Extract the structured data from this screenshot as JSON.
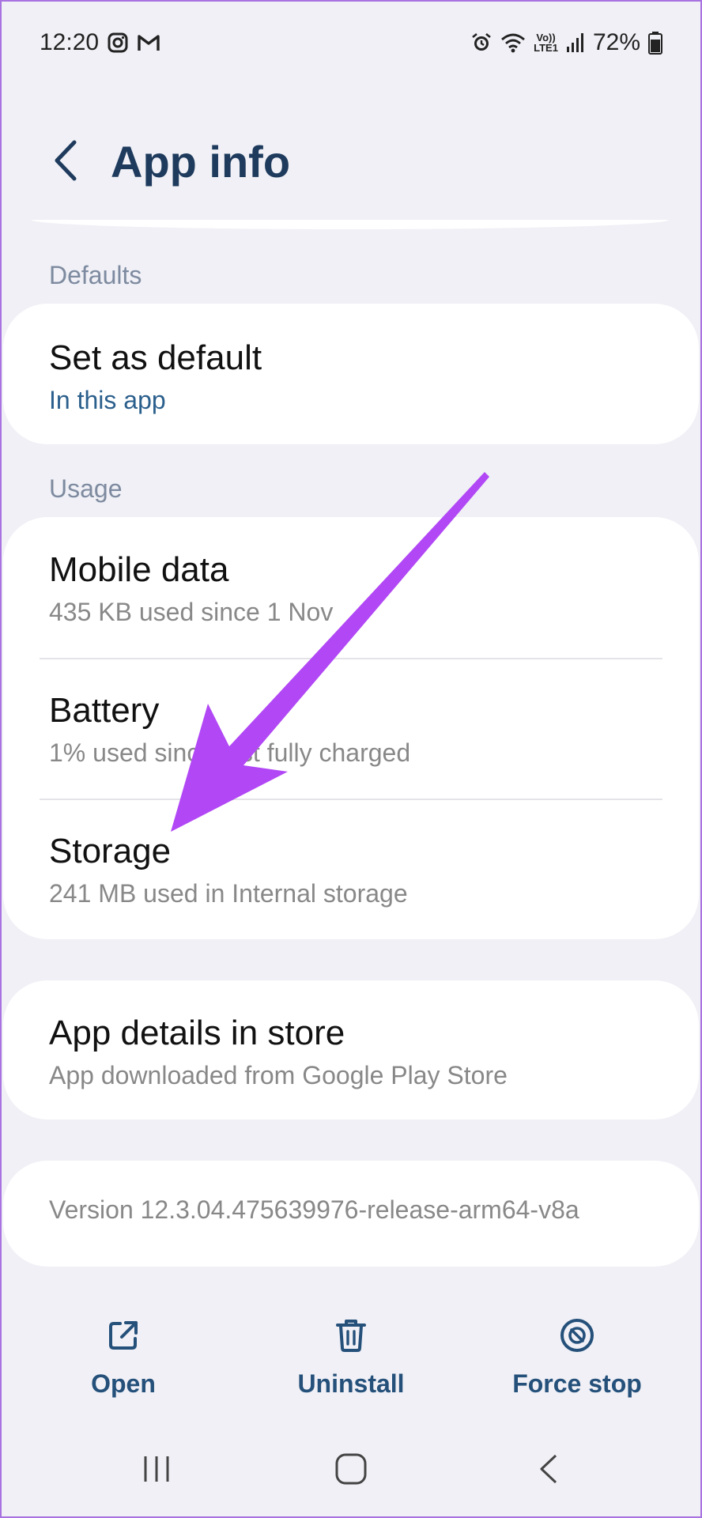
{
  "status_bar": {
    "time": "12:20",
    "left_icons": [
      "instagram-icon",
      "gmail-icon"
    ],
    "right_icons": [
      "alarm-icon",
      "wifi-icon",
      "volte-icon",
      "signal-icon",
      "battery-icon"
    ],
    "network_label_top": "Vo))",
    "network_label_bottom": "LTE1",
    "battery": "72%"
  },
  "header": {
    "title": "App info",
    "back_icon": "chevron-left-icon"
  },
  "sections": {
    "defaults_label": "Defaults",
    "usage_label": "Usage"
  },
  "defaults": {
    "set_as_default": {
      "title": "Set as default",
      "subtitle": "In this app"
    }
  },
  "usage": {
    "mobile_data": {
      "title": "Mobile data",
      "subtitle": "435 KB used since 1 Nov"
    },
    "battery": {
      "title": "Battery",
      "subtitle": "1% used since last fully charged"
    },
    "storage": {
      "title": "Storage",
      "subtitle": "241 MB used in Internal storage"
    }
  },
  "store": {
    "title": "App details in store",
    "subtitle": "App downloaded from Google Play Store"
  },
  "version": "Version 12.3.04.475639976-release-arm64-v8a",
  "actions": {
    "open": {
      "label": "Open",
      "icon": "open-external-icon"
    },
    "uninstall": {
      "label": "Uninstall",
      "icon": "trash-icon"
    },
    "force_stop": {
      "label": "Force stop",
      "icon": "stop-icon"
    }
  },
  "nav": {
    "recents_icon": "recents-icon",
    "home_icon": "home-icon",
    "back_icon": "back-icon"
  },
  "colors": {
    "accent": "#24507a",
    "title": "#1e3a5c",
    "annotation_arrow": "#b147f5",
    "background": "#f0f0f6"
  }
}
